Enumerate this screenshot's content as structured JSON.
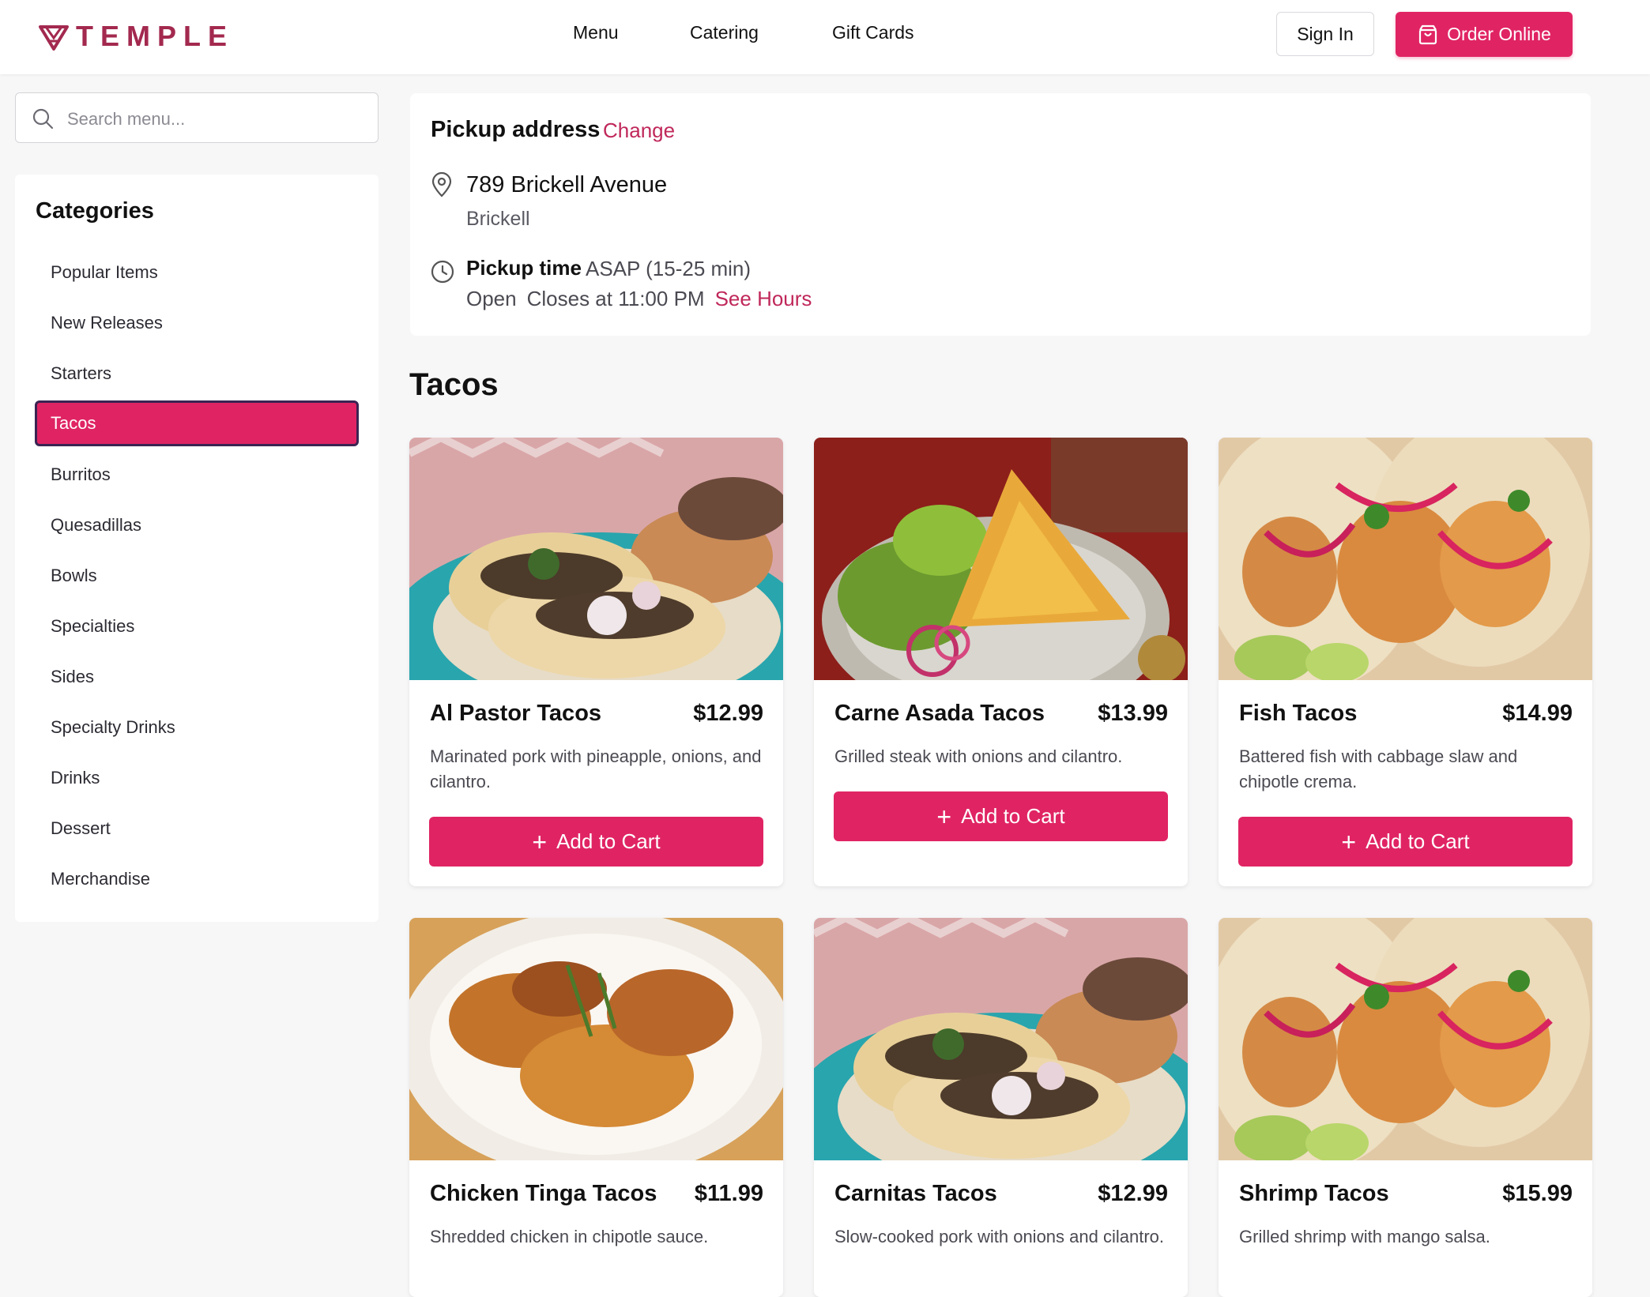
{
  "header": {
    "logo_text": "TEMPLE",
    "nav": [
      "Menu",
      "Catering",
      "Gift Cards"
    ],
    "sign_in": "Sign In",
    "order_online": "Order Online"
  },
  "search": {
    "placeholder": "Search menu..."
  },
  "categories": {
    "title": "Categories",
    "items": [
      "Popular Items",
      "New Releases",
      "Starters",
      "Tacos",
      "Burritos",
      "Quesadillas",
      "Bowls",
      "Specialties",
      "Sides",
      "Specialty Drinks",
      "Drinks",
      "Dessert",
      "Merchandise"
    ],
    "active": "Tacos"
  },
  "pickup": {
    "label": "Pickup address",
    "change": "Change",
    "address_line1": "789 Brickell Avenue",
    "address_line2": "Brickell",
    "time_label": "Pickup time",
    "time_value": "ASAP (15-25 min)",
    "status": "Open",
    "closes": "Closes at 11:00 PM",
    "see_hours": "See Hours"
  },
  "section_title": "Tacos",
  "add_to_cart": "Add to Cart",
  "products": [
    {
      "name": "Al Pastor Tacos",
      "price": "$12.99",
      "description": "Marinated pork with pineapple, onions, and cilantro."
    },
    {
      "name": "Carne Asada Tacos",
      "price": "$13.99",
      "description": "Grilled steak with onions and cilantro."
    },
    {
      "name": "Fish Tacos",
      "price": "$14.99",
      "description": "Battered fish with cabbage slaw and chipotle crema."
    },
    {
      "name": "Chicken Tinga Tacos",
      "price": "$11.99",
      "description": "Shredded chicken in chipotle sauce."
    },
    {
      "name": "Carnitas Tacos",
      "price": "$12.99",
      "description": "Slow-cooked pork with onions and cilantro."
    },
    {
      "name": "Shrimp Tacos",
      "price": "$15.99",
      "description": "Grilled shrimp with mango salsa."
    }
  ],
  "colors": {
    "accent": "#e02463",
    "brand": "#a3294f",
    "link": "#c0285a"
  }
}
